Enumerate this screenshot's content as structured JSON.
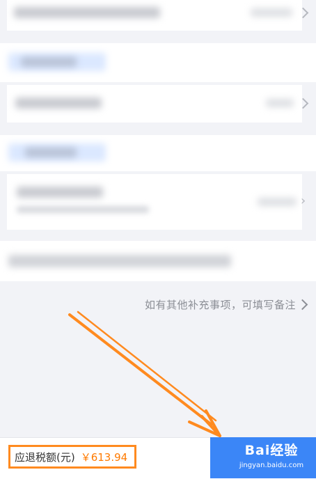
{
  "footer": {
    "remark_hint": "如有其他补充事项，可填写备注",
    "refund_label": "应退税额(元)",
    "refund_amount": "￥613.94"
  },
  "watermark": {
    "brand": "Bai经验",
    "url": "jingyan.baidu.com"
  },
  "colors": {
    "highlight_orange": "#ff8a1f",
    "primary_blue": "#3b86f7"
  }
}
